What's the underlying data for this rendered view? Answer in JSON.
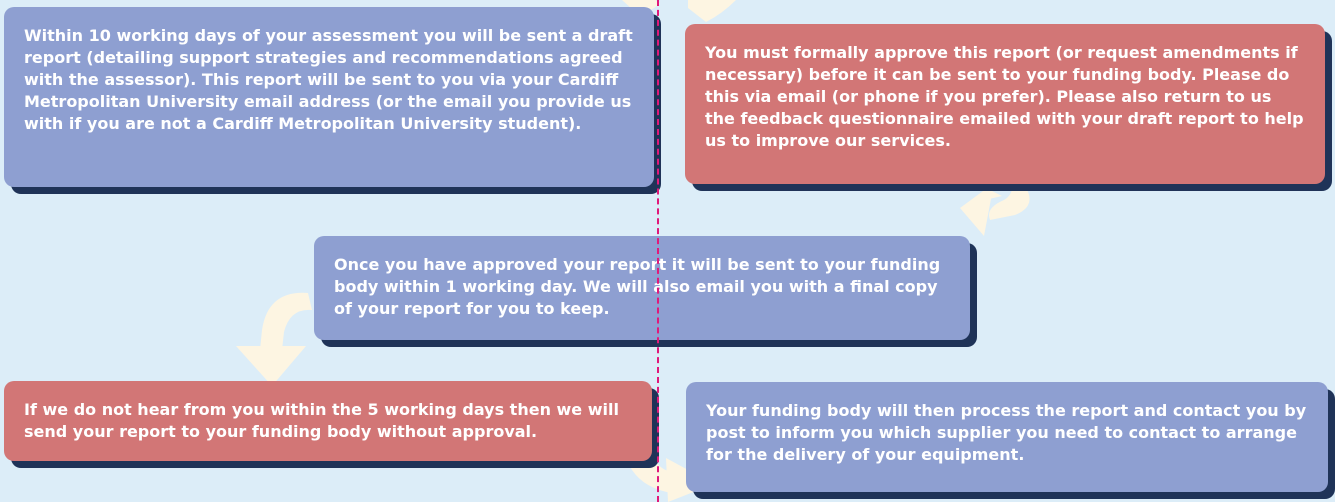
{
  "steps": [
    {
      "id": "draft-report",
      "text": "Within 10 working days of your assessment you will be sent a draft report (detailing support strategies and recommendations agreed with the assessor). This report will be sent to you via your Cardiff Metropolitan University email address (or the email you provide us with if you are not a Cardiff Metropolitan University student).",
      "color": "#8e9fd1"
    },
    {
      "id": "approve-report",
      "text": "You must formally approve this report (or request amendments if necessary) before it can be sent to your funding body. Please do this via email (or phone if you prefer). Please also return to us the feedback questionnaire emailed with your draft report to help us to improve our services.",
      "color": "#d27676"
    },
    {
      "id": "report-sent",
      "text": "Once you have approved your report it will be sent to your funding body within 1 working day. We will also email you with a final copy of your report for you to keep.",
      "color": "#8e9fd1"
    },
    {
      "id": "no-approval",
      "text": "If we do not hear from you within the 5 working days then we will send your report to your funding body without approval.",
      "color": "#d27676"
    },
    {
      "id": "funding-process",
      "text": "Your funding body will then process the report and contact you by post to inform you which supplier you need to contact to arrange for the delivery of your equipment.",
      "color": "#8e9fd1"
    }
  ],
  "colors": {
    "background": "#dcedf8",
    "box_blue": "#8e9fd1",
    "box_red": "#d27676",
    "box_shadow": "#1f3358",
    "arrow": "#fdf5e2",
    "divider": "#e0197a"
  },
  "icons": [
    "curved-arrow-icon"
  ]
}
